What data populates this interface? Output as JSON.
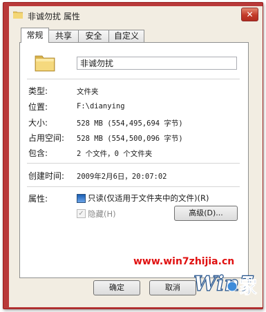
{
  "window": {
    "title": "非诚勿扰 属性",
    "close_glyph": "✕"
  },
  "tabs": [
    {
      "label": "常规",
      "active": true
    },
    {
      "label": "共享",
      "active": false
    },
    {
      "label": "安全",
      "active": false
    },
    {
      "label": "自定义",
      "active": false
    }
  ],
  "general": {
    "name_value": "非诚勿扰",
    "rows": [
      {
        "label": "类型:",
        "value": "文件夹"
      },
      {
        "label": "位置:",
        "value": "F:\\dianying"
      },
      {
        "label": "大小:",
        "value": "528 MB (554,495,694 字节)"
      },
      {
        "label": "占用空间:",
        "value": "528 MB (554,500,096 字节)"
      },
      {
        "label": "包含:",
        "value": "2 个文件，0 个文件夹"
      },
      {
        "label": "创建时间:",
        "value": "2009年2月6日，20:07:02"
      }
    ],
    "attributes_label": "属性:",
    "readonly_label": "只读(仅适用于文件夹中的文件)(R)",
    "hidden_label": "隐藏(H)",
    "advanced_label": "高级(D)...",
    "hidden_check": "✓"
  },
  "buttons": {
    "ok": "确定",
    "cancel": "取消"
  },
  "watermark": {
    "url": "www.win7zhijia.cn",
    "logo_text": "Win7",
    "logo_suffix": "家"
  },
  "icons": {
    "folder": "folder-icon",
    "close": "close-icon"
  },
  "colors": {
    "frame": "#b93a3a",
    "accent": "#1a5fb4",
    "watermark": "#e01010"
  }
}
